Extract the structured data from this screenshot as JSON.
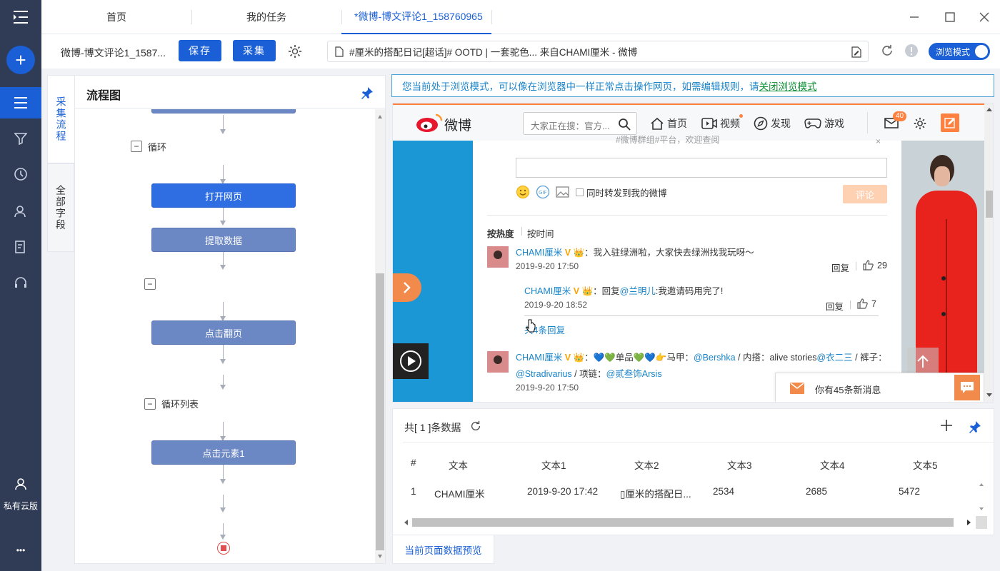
{
  "nav": {
    "private_label": "私有云版",
    "more": "•••"
  },
  "tabs": [
    {
      "label": "首页"
    },
    {
      "label": "我的任务"
    },
    {
      "label": "*微博-博文评论1_158760965"
    }
  ],
  "toolbar": {
    "task_name": "微博-博文评论1_1587...",
    "save_label": "保存",
    "collect_label": "采集",
    "url_text": "#厘米的搭配日记[超话]# OOTD | 一套驼色... 来自CHAMI厘米 - 微博",
    "browse_mode_label": "浏览模式"
  },
  "side_tabs": {
    "flow": "采集流程",
    "fields": "全部字段"
  },
  "flow": {
    "title": "流程图",
    "loop_label": "循环",
    "loop_list_label": "循环列表",
    "nodes": {
      "open_page": "打开网页",
      "extract": "提取数据",
      "next_page": "点击翻页",
      "click_elem": "点击元素1"
    }
  },
  "notice": {
    "text": "您当前处于浏览模式，可以像在浏览器中一样正常点击操作网页，如需编辑规则，请",
    "link": "关闭浏览模式"
  },
  "weibo": {
    "logo": "微博",
    "search_placeholder": "大家正在搜：官方...",
    "nav": [
      "首页",
      "视频",
      "发现",
      "游戏"
    ],
    "msg_badge": "40",
    "top_hint": "#微博群组#平台，欢迎查阅",
    "forward_label": "同时转发到我的微博",
    "comment_btn": "评论",
    "sort_hot": "按热度",
    "sort_time": "按时间",
    "comments": [
      {
        "user": "CHAMI厘米",
        "text": "：我入驻绿洲啦，大家快去绿洲找我玩呀～",
        "time": "2019-9-20 17:50",
        "reply": "回复",
        "likes": "29"
      },
      {
        "user": "CHAMI厘米",
        "text_prefix": "：回复",
        "mention": "@兰明儿",
        "text_suffix": ":我邀请码用完了!",
        "time": "2019-9-20 18:52",
        "reply": "回复",
        "likes": "7"
      },
      {
        "more_replies": "共4条回复"
      },
      {
        "user": "CHAMI厘米",
        "text_a": "：💙💚单品💚💙👉马甲：",
        "m1": "@Bershka",
        "text_b": " / 内搭：alive stories",
        "m2": "@衣二三",
        "text_c": " / 裤子：",
        "m3": "@Stradivarius",
        "text_d": " / 项链：",
        "m4": "@贰叁饰Arsis",
        "time": "2019-9-20 17:50"
      }
    ],
    "new_msg": "你有45条新消息"
  },
  "data_panel": {
    "count_label": "共[ 1 ]条数据",
    "headers": [
      "#",
      "文本",
      "文本1",
      "文本2",
      "文本3",
      "文本4",
      "文本5"
    ],
    "rows": [
      [
        "1",
        "CHAMI厘米",
        "2019-9-20 17:42",
        "▯厘米的搭配日...",
        "2534",
        "2685",
        "5472"
      ]
    ],
    "bottom_tab": "当前页面数据预览"
  },
  "colors": {
    "primary": "#1a5fd6",
    "nav_bg": "#303b55",
    "node": "#6c88c4",
    "node_active": "#2f6de3"
  }
}
